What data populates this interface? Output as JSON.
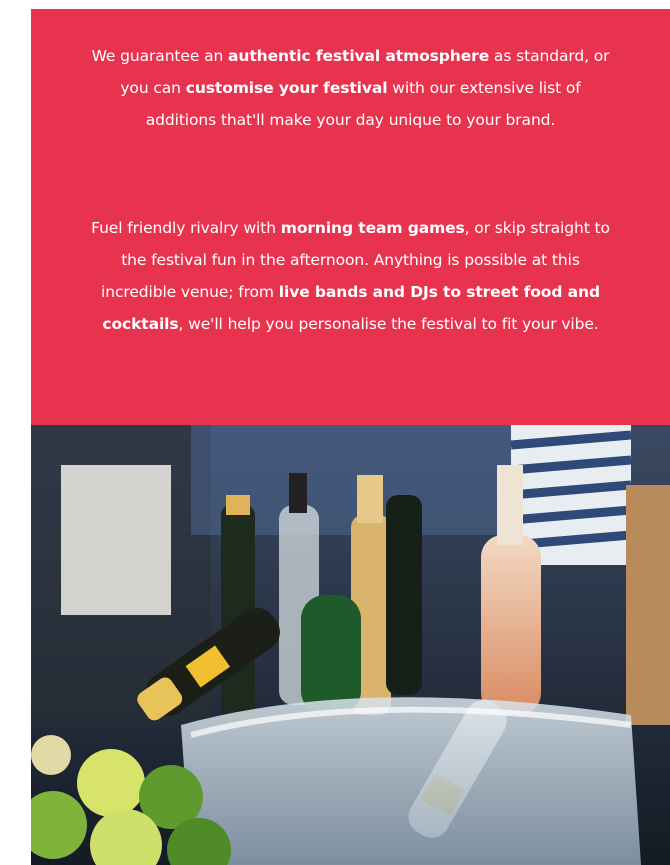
{
  "intro": {
    "lines": [
      [
        {
          "text": "We guarantee an ",
          "bold": false
        },
        {
          "text": "authentic festival atmosphere",
          "bold": true
        },
        {
          "text": " as standard, or",
          "bold": false
        }
      ],
      [
        {
          "text": "you can ",
          "bold": false
        },
        {
          "text": "customise your festival",
          "bold": true
        },
        {
          "text": " with our extensive list of",
          "bold": false
        }
      ],
      [
        {
          "text": "additions that'll make your day unique to your brand.",
          "bold": false
        }
      ]
    ]
  },
  "details": {
    "lines": [
      [
        {
          "text": "Fuel friendly rivalry with ",
          "bold": false
        },
        {
          "text": "morning team games",
          "bold": true
        },
        {
          "text": ", or skip straight to",
          "bold": false
        }
      ],
      [
        {
          "text": "the festival fun in the afternoon. Anything is possible at this",
          "bold": false
        }
      ],
      [
        {
          "text": "incredible venue; from ",
          "bold": false
        },
        {
          "text": "live bands and DJs to street food and",
          "bold": true
        }
      ],
      [
        {
          "text": "cocktails",
          "bold": true
        },
        {
          "text": ", we'll help you personalise the festival to fit your vibe.",
          "bold": false
        }
      ]
    ]
  },
  "colors": {
    "panel_background": "#e8334f",
    "panel_text": "#ffffff"
  }
}
